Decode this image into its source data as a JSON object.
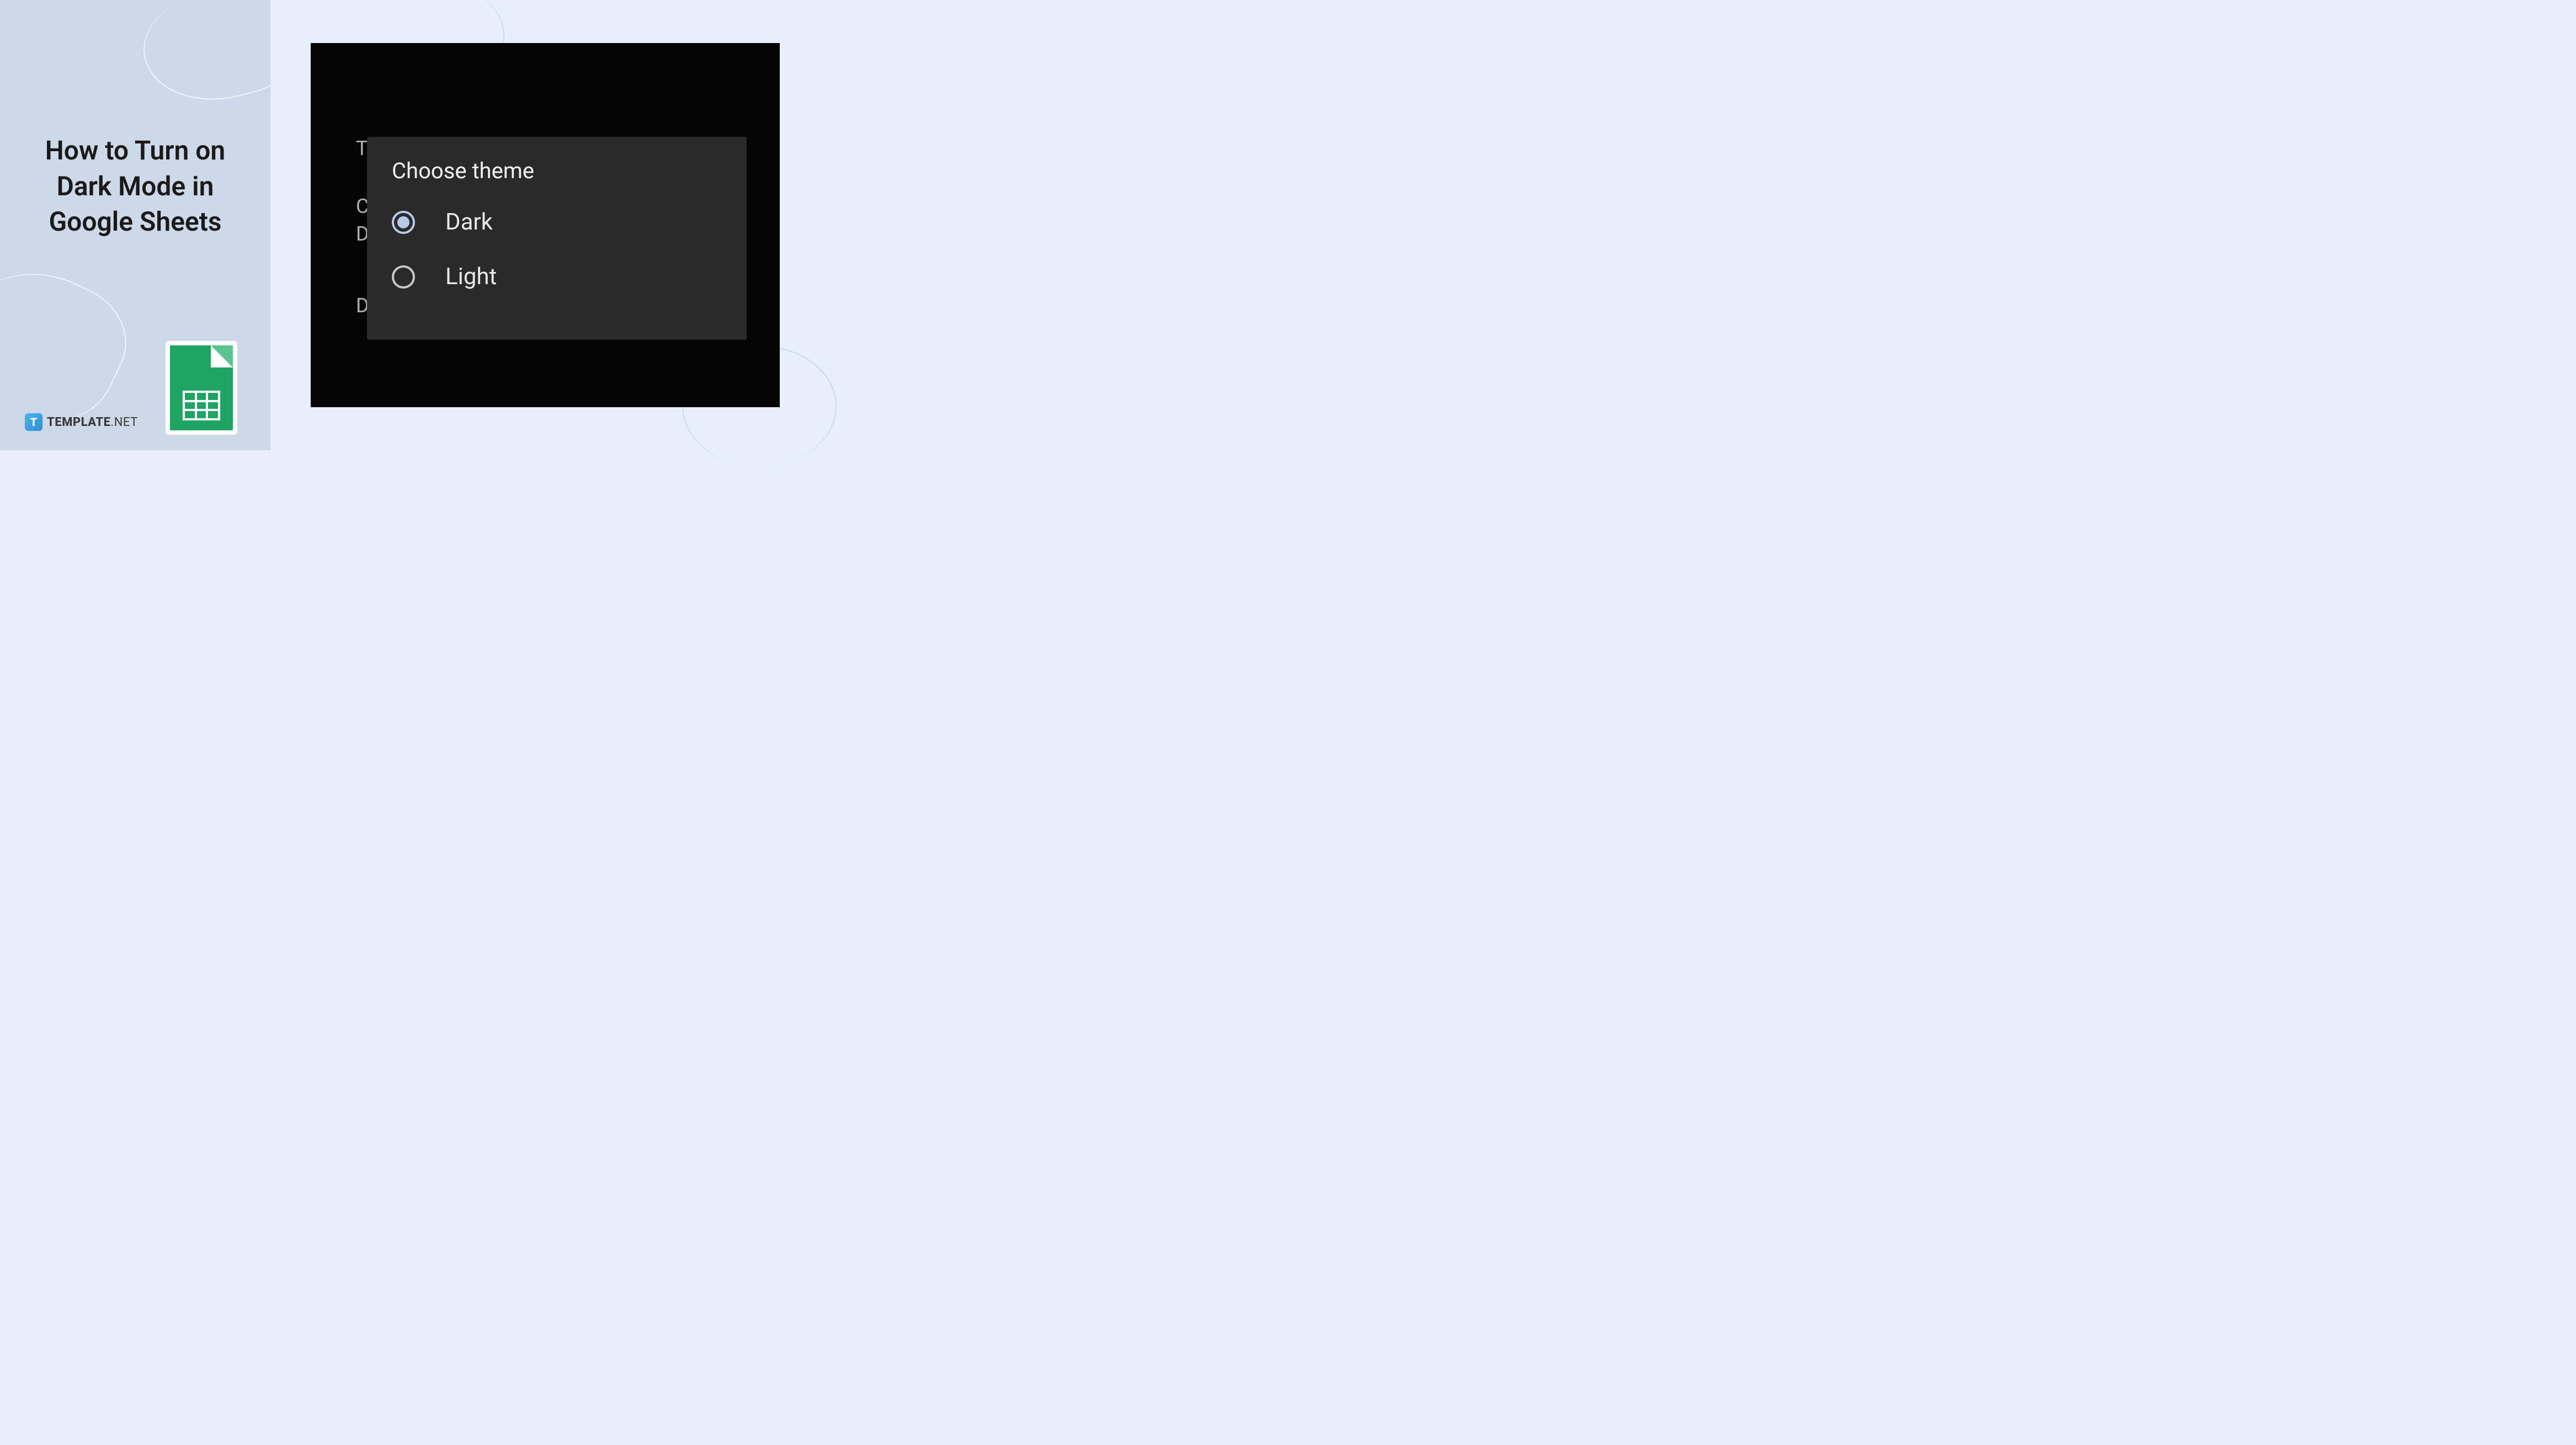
{
  "title": "How to Turn on Dark Mode in Google Sheets",
  "logo": {
    "letter": "T",
    "brand": "TEMPLATE",
    "suffix": ".NET"
  },
  "screenshot": {
    "bg_labels": {
      "theme": "T",
      "c": "C",
      "d": "D",
      "d2": "D"
    },
    "dialog": {
      "title": "Choose theme",
      "options": [
        {
          "label": "Dark",
          "selected": true
        },
        {
          "label": "Light",
          "selected": false
        }
      ]
    }
  }
}
